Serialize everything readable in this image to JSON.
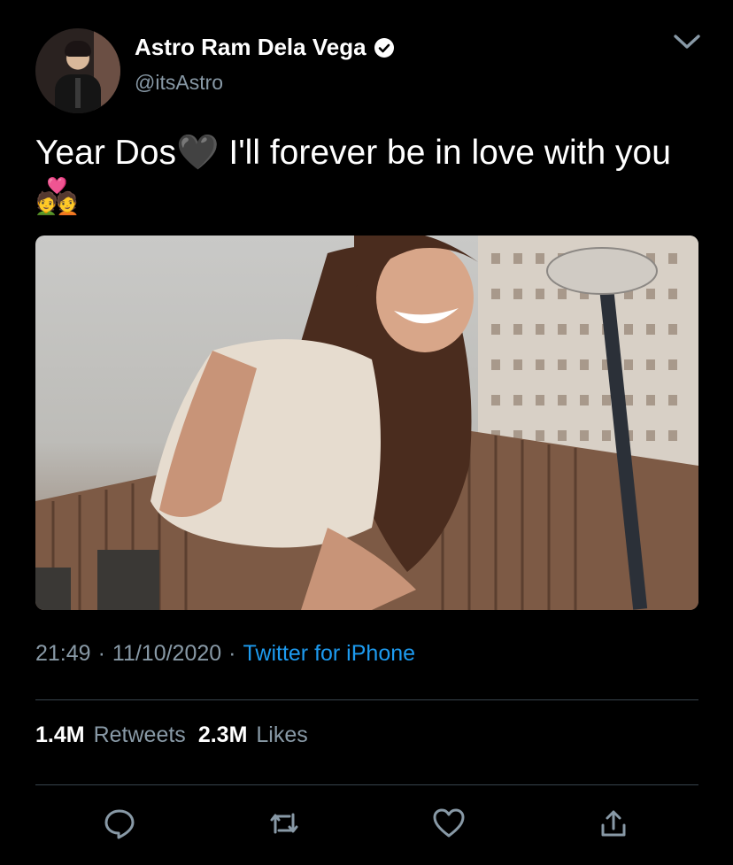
{
  "author": {
    "display_name": "Astro Ram Dela Vega",
    "handle": "@itsAstro",
    "verified": true
  },
  "tweet": {
    "text": "Year Dos🖤 I'll forever be in love with you💑"
  },
  "meta": {
    "time": "21:49",
    "date": "11/10/2020",
    "separator": "·",
    "source": "Twitter for iPhone"
  },
  "stats": {
    "retweets_count": "1.4M",
    "retweets_label": "Retweets",
    "likes_count": "2.3M",
    "likes_label": "Likes"
  },
  "icons": {
    "menu": "chevron-down-icon",
    "reply": "reply-icon",
    "retweet": "retweet-icon",
    "like": "heart-icon",
    "share": "share-icon"
  },
  "colors": {
    "background": "#000000",
    "secondary_text": "#8899a6",
    "link": "#1d9bf0",
    "divider": "#38444d"
  }
}
